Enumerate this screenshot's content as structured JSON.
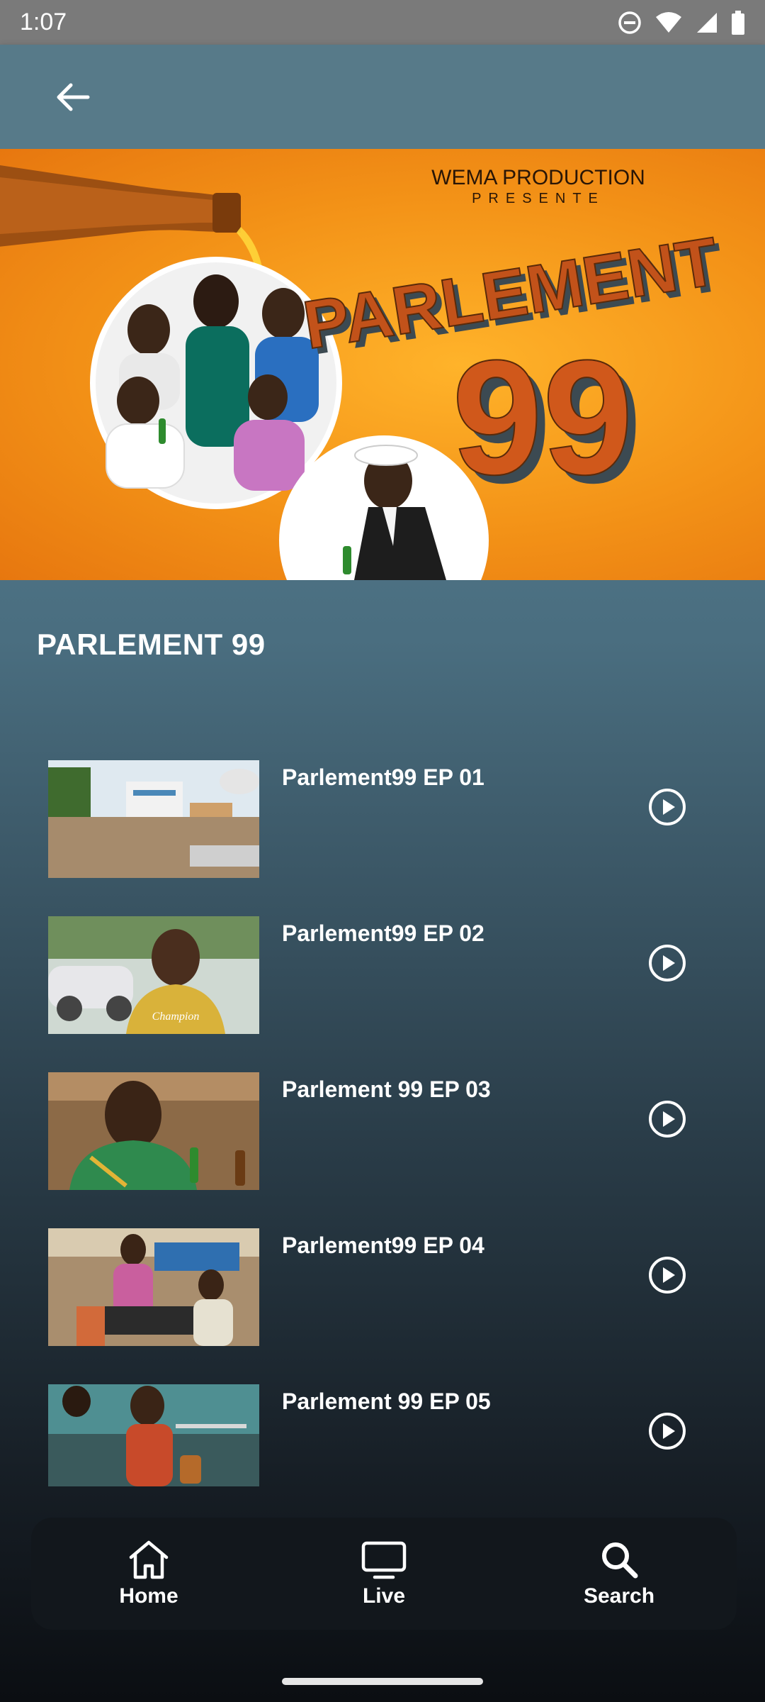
{
  "status_bar": {
    "time": "1:07"
  },
  "hero": {
    "producer_line1": "WEMA PRODUCTION",
    "producer_line2": "PRESENTE",
    "title_word": "PARLEMENT",
    "title_number": "99"
  },
  "show": {
    "title": "PARLEMENT 99"
  },
  "episodes": [
    {
      "title": "Parlement99 EP 01"
    },
    {
      "title": "Parlement99 EP 02"
    },
    {
      "title": "Parlement 99 EP 03"
    },
    {
      "title": "Parlement99 EP 04"
    },
    {
      "title": "Parlement 99 EP 05"
    }
  ],
  "thumb_text": {
    "ep02_shirt": "Champion"
  },
  "nav": {
    "home_label": "Home",
    "live_label": "Live",
    "search_label": "Search"
  },
  "icons": {
    "back": "arrow-left-icon",
    "play": "play-circle-icon",
    "home": "home-icon",
    "live": "tv-icon",
    "search": "search-icon"
  }
}
